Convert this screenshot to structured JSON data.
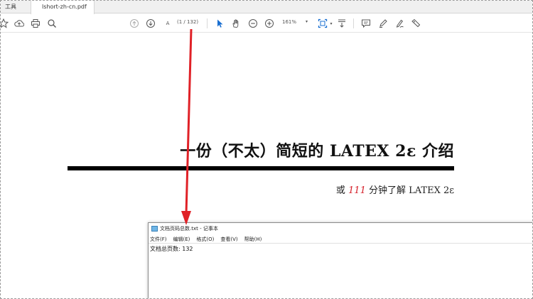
{
  "tabs": {
    "tools": "工具",
    "document": "lshort-zh-cn.pdf"
  },
  "toolbar": {
    "page_input": "A",
    "page_indicator": "(1 / 132)",
    "zoom": "161%"
  },
  "document": {
    "title": "一份（不太）简短的 LATEX 2ε 介绍",
    "subtitle_prefix": "或 ",
    "subtitle_number": "111",
    "subtitle_suffix": " 分钟了解 LATEX 2ε"
  },
  "notepad": {
    "title": "文档页码总数.txt - 记事本",
    "menu": [
      "文件(F)",
      "编辑(E)",
      "格式(O)",
      "查看(V)",
      "帮助(H)"
    ],
    "content": "文档总页数: 132"
  },
  "colors": {
    "arrow": "#e02127",
    "accent_number": "#d6202a"
  }
}
